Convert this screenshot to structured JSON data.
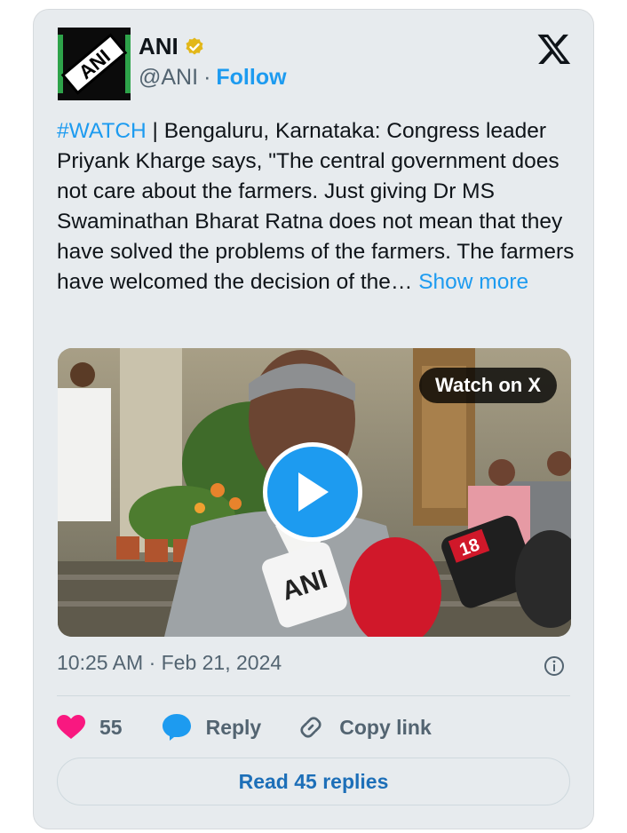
{
  "author": {
    "name": "ANI",
    "handle": "@ANI",
    "separator": "·",
    "follow_label": "Follow",
    "logo_text": "ANI"
  },
  "tweet": {
    "hashtag": "#WATCH",
    "body": " | Bengaluru, Karnataka: Congress leader Priyank Kharge says, \"The central government does not care about the farmers. Just giving Dr MS Swaminathan Bharat Ratna does not mean that they have solved the problems of the farmers. The farmers have welcomed the decision of the… ",
    "show_more": "Show more"
  },
  "media": {
    "watch_label": "Watch on X",
    "mic_labels": [
      "ANI",
      "18"
    ]
  },
  "meta": {
    "timestamp": "10:25 AM · Feb 21, 2024"
  },
  "actions": {
    "likes": "55",
    "reply_label": "Reply",
    "copy_label": "Copy link"
  },
  "read_replies_label": "Read 45 replies",
  "colors": {
    "accent": "#1d9bf0",
    "like": "#f91880",
    "card_bg": "#e7ebee"
  }
}
